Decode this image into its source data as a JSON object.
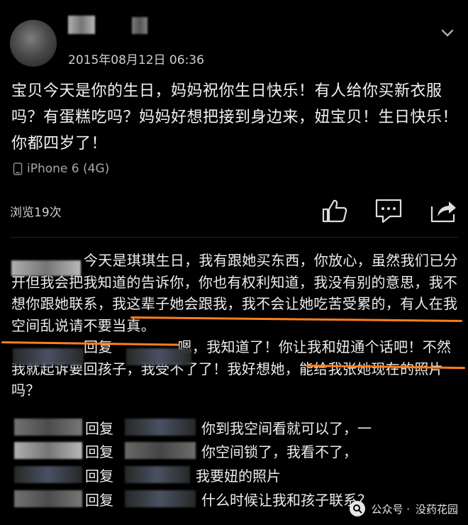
{
  "post": {
    "timestamp": "2015年08月12日 06:36",
    "text": "宝贝今天是你的生日，妈妈祝你生日快乐！有人给你买新衣服吗？有蛋糕吃吗？妈妈好想把接到身边来，妞宝贝！生日快乐！你都四岁了！",
    "device": "iPhone 6 (4G)",
    "views": "浏览19次"
  },
  "comments": [
    {
      "text": "今天是琪琪生日，我有跟她买东西，你放心，虽然我们已分开但我会把我知道的告诉你，你也有权利知道，我没有别的意思，我不想你跟她联系，我这辈子她会跟我，我不会让她吃苦受累的，有人在我空间乱说请不要当真。"
    },
    {
      "reply_word": "回复",
      "text": "嗯，我知道了！你让我和妞通个话吧！不然我就起诉要回孩子，我受不了了！我好想她，能给我张她现在的照片吗？"
    },
    {
      "reply_word": "回复",
      "text": "你到我空间看就可以了，一"
    },
    {
      "reply_word": "回复",
      "text": "你空间锁了，我看不了，"
    },
    {
      "reply_word": "回复",
      "text": "我要妞的照片"
    },
    {
      "reply_word": "回复",
      "text": "什么时候让我和孩子联系？"
    }
  ],
  "watermark": {
    "prefix": "公众号 ·",
    "name": "没药花园"
  },
  "colors": {
    "highlight": "#ff7f1a",
    "background": "#000000"
  },
  "icons": [
    "chevron-down-icon",
    "phone-icon",
    "like-icon",
    "comment-icon",
    "share-icon"
  ]
}
